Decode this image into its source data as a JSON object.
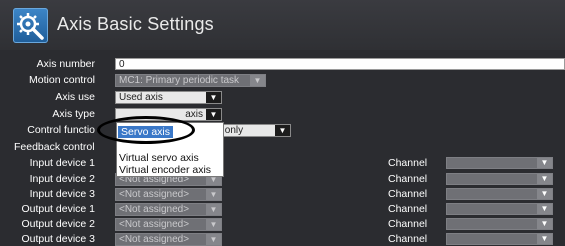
{
  "header": {
    "title": "Axis Basic Settings",
    "icon": "axis-settings-icon"
  },
  "fields": {
    "axis_number": {
      "label": "Axis number",
      "value": "0"
    },
    "motion_control": {
      "label": "Motion control",
      "value": "MC1: Primary periodic task"
    },
    "axis_use": {
      "label": "Axis use",
      "value": "Used axis"
    },
    "axis_type": {
      "label": "Axis type",
      "value": "axis"
    },
    "control_function": {
      "label": "Control functio",
      "value": "ontrol only"
    },
    "feedback_control": {
      "label": "Feedback control"
    }
  },
  "axis_type_dropdown": {
    "options": [
      "Servo axis",
      "Virtual servo axis",
      "Virtual encoder axis"
    ],
    "selected": "Servo axis"
  },
  "devices": [
    {
      "label": "Input device 1",
      "value": "",
      "channel_label": "Channel"
    },
    {
      "label": "Input device 2",
      "value": "<Not assigned>",
      "channel_label": "Channel"
    },
    {
      "label": "Input device 3",
      "value": "<Not assigned>",
      "channel_label": "Channel"
    },
    {
      "label": "Output device 1",
      "value": "<Not assigned>",
      "channel_label": "Channel"
    },
    {
      "label": "Output device 2",
      "value": "<Not assigned>",
      "channel_label": "Channel"
    },
    {
      "label": "Output device 3",
      "value": "<Not assigned>",
      "channel_label": "Channel"
    }
  ],
  "colors": {
    "background": "#2b2c30",
    "selection": "#3a78c8",
    "disabled_field": "#6f7075"
  }
}
